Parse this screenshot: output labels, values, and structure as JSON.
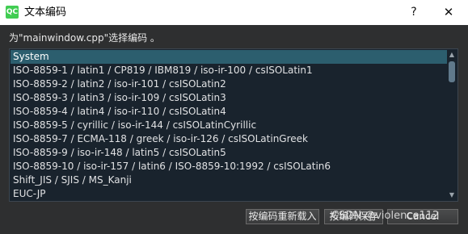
{
  "window": {
    "icon_text": "QC",
    "title": "文本编码",
    "help_glyph": "?",
    "close_glyph": "✕"
  },
  "prompt": "为\"mainwindow.cpp\"选择编码 。",
  "encodings": [
    "System",
    "ISO-8859-1 / latin1 / CP819 / IBM819 / iso-ir-100 / csISOLatin1",
    "ISO-8859-2 / latin2 / iso-ir-101 / csISOLatin2",
    "ISO-8859-3 / latin3 / iso-ir-109 / csISOLatin3",
    "ISO-8859-4 / latin4 / iso-ir-110 / csISOLatin4",
    "ISO-8859-5 / cyrillic / iso-ir-144 / csISOLatinCyrillic",
    "ISO-8859-7 / ECMA-118 / greek / iso-ir-126 / csISOLatinGreek",
    "ISO-8859-9 / iso-ir-148 / latin5 / csISOLatin5",
    "ISO-8859-10 / iso-ir-157 / latin6 / ISO-8859-10:1992 / csISOLatin6",
    "Shift_JIS / SJIS / MS_Kanji",
    "EUC-JP"
  ],
  "selected_index": 0,
  "scrollbar": {
    "up_glyph": "▲",
    "down_glyph": "▼",
    "position_fraction": 0.0
  },
  "buttons": {
    "reload": "按编码重新载入",
    "save": "按编码保存",
    "cancel": "Cancel"
  },
  "watermark": "CSDN @violence112",
  "colors": {
    "body_bg": "#2e2f30",
    "list_bg": "#19232d",
    "selection": "#2c5e6e"
  }
}
